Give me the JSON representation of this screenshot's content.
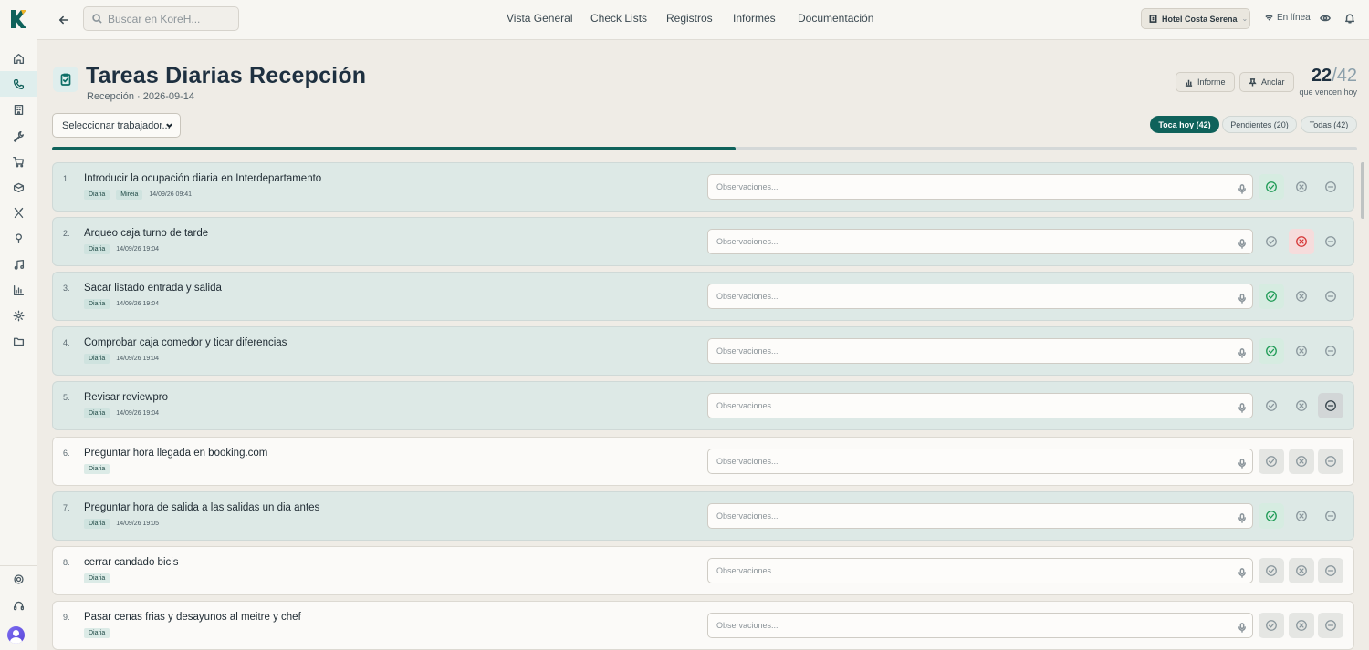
{
  "app": {
    "logo_letter": "K",
    "brand_color": "#0f625b"
  },
  "sidebar": {
    "items": [
      {
        "name": "home-icon",
        "active": false
      },
      {
        "name": "phone-icon",
        "active": true
      },
      {
        "name": "building-icon",
        "active": false
      },
      {
        "name": "wrench-icon",
        "active": false
      },
      {
        "name": "cart-icon",
        "active": false
      },
      {
        "name": "box-icon",
        "active": false
      },
      {
        "name": "utensils-icon",
        "active": false
      },
      {
        "name": "pin-icon",
        "active": false
      },
      {
        "name": "music-icon",
        "active": false
      },
      {
        "name": "chart-icon",
        "active": false
      },
      {
        "name": "settings-icon",
        "active": false
      },
      {
        "name": "folder-icon",
        "active": false
      }
    ],
    "bottom": [
      "gear-icon",
      "headset-icon",
      "avatar"
    ]
  },
  "topbar": {
    "search_placeholder": "Buscar en KoreH...",
    "nav": [
      "Vista General",
      "Check Lists",
      "Registros",
      "Informes",
      "Documentación"
    ],
    "hotel": "Hotel Costa Serena",
    "status": "En línea"
  },
  "header": {
    "title": "Tareas Diarias Recepción",
    "subtitle": "Recepción · 2026-09-14",
    "report_label": "Informe",
    "pin_label": "Anclar",
    "done_count": "22",
    "total_count": "/42",
    "counter_caption": "que vencen hoy"
  },
  "filters": {
    "worker_select": "Seleccionar trabajador...",
    "tabs": [
      "Toca hoy (42)",
      "Pendientes (20)",
      "Todas (42)"
    ],
    "active_tab": 0
  },
  "progress": {
    "completed": 22,
    "total": 42
  },
  "tasks": [
    {
      "num": "1.",
      "name": "Introducir la ocupación diaria en Interdepartamento",
      "freq": "Diaria",
      "user": "Mireia",
      "time": "14/09/26 09:41",
      "placeholder": "Observaciones...",
      "status": "ok"
    },
    {
      "num": "2.",
      "name": "Arqueo caja turno de tarde",
      "freq": "Diaria",
      "user": "",
      "time": "14/09/26 19:04",
      "placeholder": "Observaciones...",
      "status": "ko"
    },
    {
      "num": "3.",
      "name": "Sacar listado entrada y salida",
      "freq": "Diaria",
      "user": "",
      "time": "14/09/26 19:04",
      "placeholder": "Observaciones...",
      "status": "ok"
    },
    {
      "num": "4.",
      "name": "Comprobar caja comedor y ticar diferencias",
      "freq": "Diaria",
      "user": "",
      "time": "14/09/26 19:04",
      "placeholder": "Observaciones...",
      "status": "ok"
    },
    {
      "num": "5.",
      "name": "Revisar reviewpro",
      "freq": "Diaria",
      "user": "",
      "time": "14/09/26 19:04",
      "placeholder": "Observaciones...",
      "status": "na"
    },
    {
      "num": "6.",
      "name": "Preguntar hora llegada en booking.com",
      "freq": "Diaria",
      "user": "",
      "time": "",
      "placeholder": "Observaciones...",
      "status": "open"
    },
    {
      "num": "7.",
      "name": "Preguntar hora de salida a las salidas un dia antes",
      "freq": "Diaria",
      "user": "",
      "time": "14/09/26 19:05",
      "placeholder": "Observaciones...",
      "status": "ok"
    },
    {
      "num": "8.",
      "name": "cerrar candado bicis",
      "freq": "Diaria",
      "user": "",
      "time": "",
      "placeholder": "Observaciones...",
      "status": "open"
    },
    {
      "num": "9.",
      "name": "Pasar cenas frias y desayunos al meitre y chef",
      "freq": "Diaria",
      "user": "",
      "time": "",
      "placeholder": "Observaciones...",
      "status": "open"
    }
  ]
}
